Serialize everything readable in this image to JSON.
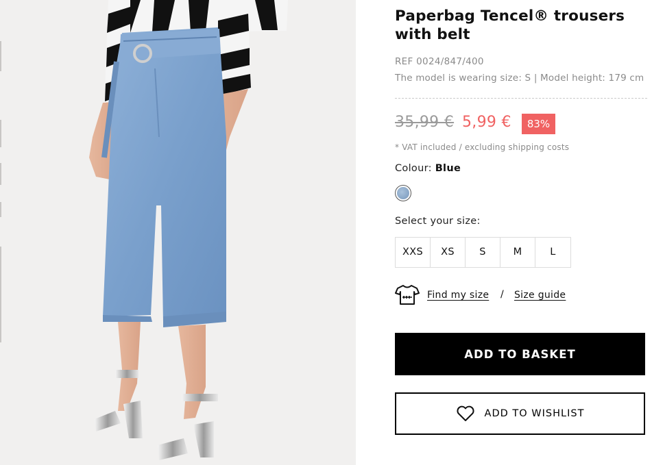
{
  "product": {
    "title_line1": "Paperbag Tencel® trousers",
    "title_line2": "with belt",
    "ref": "REF 0024/847/400",
    "model_info": "The model is wearing size: S | Model height: 179 cm"
  },
  "price": {
    "old": "35,99 €",
    "new": "5,99 €",
    "discount": "83%",
    "vat_note": "* VAT included / excluding shipping costs",
    "colors": {
      "sale": "#f06262",
      "old": "#9a9a9a"
    }
  },
  "colour": {
    "label": "Colour:",
    "value": "Blue",
    "swatch_color": "#8aa8cc"
  },
  "sizes": {
    "label": "Select your size:",
    "options": [
      "XXS",
      "XS",
      "S",
      "M",
      "L"
    ]
  },
  "fit": {
    "icon": "tshirt-ruler-icon",
    "find_my_size": "Find my size",
    "separator": "/",
    "size_guide": "Size guide"
  },
  "actions": {
    "add_to_basket": "ADD TO BASKET",
    "add_to_wishlist": "ADD TO WISHLIST",
    "wishlist_icon": "heart-icon"
  },
  "image": {
    "subject": "product-photo-model-wearing-denim-culottes"
  }
}
